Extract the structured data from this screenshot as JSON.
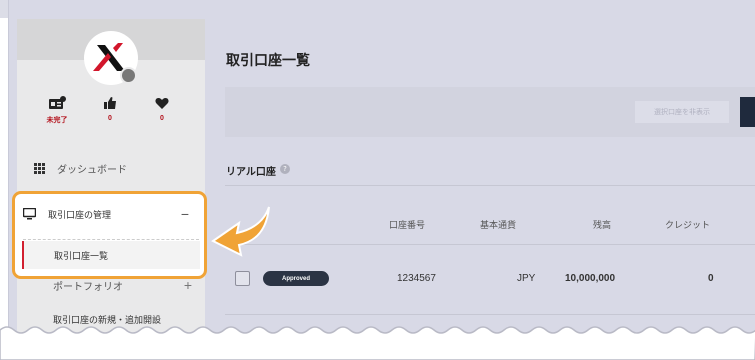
{
  "sidebar": {
    "stats": [
      {
        "icon": "id-card-icon",
        "value": "未完了"
      },
      {
        "icon": "thumbs-up-icon",
        "value": "0"
      },
      {
        "icon": "heart-icon",
        "value": "0"
      }
    ],
    "dashboard_label": "ダッシュボード",
    "account_manage_label": "取引口座の管理",
    "account_list_label": "取引口座一覧",
    "portfolio_label": "ポートフォリオ",
    "new_account_label": "取引口座の新規・追加開設"
  },
  "main": {
    "page_title": "取引口座一覧",
    "hide_selected_label": "選択口座を非表示",
    "section_title": "リアル口座",
    "columns": [
      "口座番号",
      "基本通貨",
      "残高",
      "クレジット"
    ],
    "rows": [
      {
        "status": "Approved",
        "account_number": "1234567",
        "currency": "JPY",
        "balance": "10,000,000",
        "credit": "0"
      }
    ]
  },
  "colors": {
    "accent_red": "#b3101a",
    "highlight_orange": "#f0a336",
    "badge_dark": "#2b3444"
  }
}
